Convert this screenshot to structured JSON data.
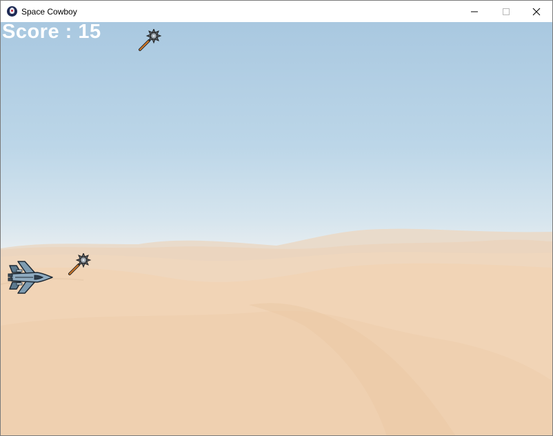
{
  "window": {
    "title": "Space Cowboy",
    "icon": "app-logo-icon",
    "controls": [
      "minimize-icon",
      "maximize-icon",
      "close-icon"
    ]
  },
  "game": {
    "score_text": "Score : 15",
    "score_color": "#ffffff",
    "player": "fighter-jet-icon",
    "projectiles": [
      "spiked-mace-icon",
      "spiked-mace-icon"
    ],
    "background": "desert-dunes"
  }
}
